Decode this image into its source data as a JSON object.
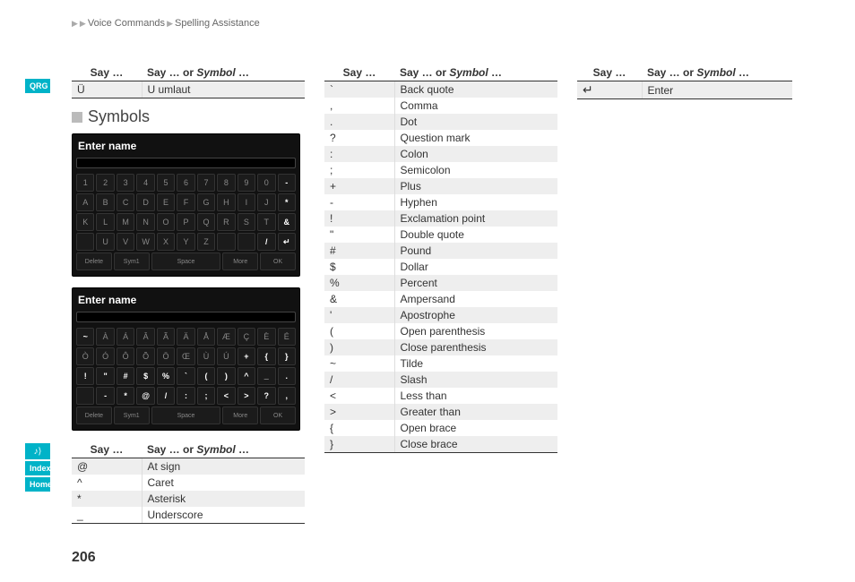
{
  "breadcrumb": {
    "item1": "Voice Commands",
    "item2": "Spelling Assistance"
  },
  "sidebar": {
    "qrg": "QRG",
    "voice": "♪",
    "index": "Index",
    "home": "Home"
  },
  "page_number": "206",
  "section_title": "Symbols",
  "headers": {
    "say": "Say …",
    "say_or": "Say … or ",
    "symbol": "Symbol",
    "ellipsis": " …"
  },
  "col1_top": [
    {
      "say": "Ü",
      "val": "U umlaut"
    }
  ],
  "col1_bottom": [
    {
      "say": "@",
      "val": "At sign"
    },
    {
      "say": "^",
      "val": "Caret"
    },
    {
      "say": "*",
      "val": "Asterisk"
    },
    {
      "say": "_",
      "val": "Underscore"
    }
  ],
  "col2": [
    {
      "say": "`",
      "val": "Back quote"
    },
    {
      "say": ",",
      "val": "Comma"
    },
    {
      "say": ".",
      "val": "Dot"
    },
    {
      "say": "?",
      "val": "Question mark"
    },
    {
      "say": ":",
      "val": "Colon"
    },
    {
      "say": ";",
      "val": "Semicolon"
    },
    {
      "say": "+",
      "val": "Plus"
    },
    {
      "say": "-",
      "val": "Hyphen"
    },
    {
      "say": "!",
      "val": "Exclamation point"
    },
    {
      "say": "\"",
      "val": "Double quote"
    },
    {
      "say": "#",
      "val": "Pound"
    },
    {
      "say": "$",
      "val": "Dollar"
    },
    {
      "say": "%",
      "val": "Percent"
    },
    {
      "say": "&",
      "val": "Ampersand"
    },
    {
      "say": "'",
      "val": "Apostrophe"
    },
    {
      "say": "(",
      "val": "Open parenthesis"
    },
    {
      "say": ")",
      "val": "Close parenthesis"
    },
    {
      "say": "~",
      "val": "Tilde"
    },
    {
      "say": "/",
      "val": "Slash"
    },
    {
      "say": "<",
      "val": "Less than"
    },
    {
      "say": ">",
      "val": "Greater than"
    },
    {
      "say": "{",
      "val": "Open brace"
    },
    {
      "say": "}",
      "val": "Close brace"
    }
  ],
  "col3": [
    {
      "say": "↵",
      "val": "Enter"
    }
  ],
  "keyboard1": {
    "title": "Enter name",
    "rows": [
      [
        "1",
        "2",
        "3",
        "4",
        "5",
        "6",
        "7",
        "8",
        "9",
        "0",
        "-"
      ],
      [
        "A",
        "B",
        "C",
        "D",
        "E",
        "F",
        "G",
        "H",
        "I",
        "J",
        "*"
      ],
      [
        "K",
        "L",
        "M",
        "N",
        "O",
        "P",
        "Q",
        "R",
        "S",
        "T",
        "&"
      ],
      [
        "",
        "U",
        "V",
        "W",
        "X",
        "Y",
        "Z",
        "",
        "",
        "/",
        "↵"
      ]
    ],
    "footer": [
      "Delete",
      "Sym1",
      "Space",
      "More",
      "OK"
    ]
  },
  "keyboard2": {
    "title": "Enter name",
    "rows": [
      [
        "~",
        "À",
        "Á",
        "Â",
        "Ã",
        "Ä",
        "Å",
        "Æ",
        "Ç",
        "È",
        "É"
      ],
      [
        "Ò",
        "Ó",
        "Ô",
        "Õ",
        "Ö",
        "Œ",
        "Ù",
        "Ú",
        "+",
        "{",
        "}"
      ],
      [
        "!",
        "\"",
        "#",
        "$",
        "%",
        "`",
        "(",
        ")",
        "^",
        "_",
        "."
      ],
      [
        "",
        "-",
        "*",
        "@",
        "/",
        ":",
        ";",
        "<",
        ">",
        "?",
        ","
      ]
    ],
    "footer": [
      "Delete",
      "Sym1",
      "Space",
      "More",
      "OK"
    ]
  }
}
